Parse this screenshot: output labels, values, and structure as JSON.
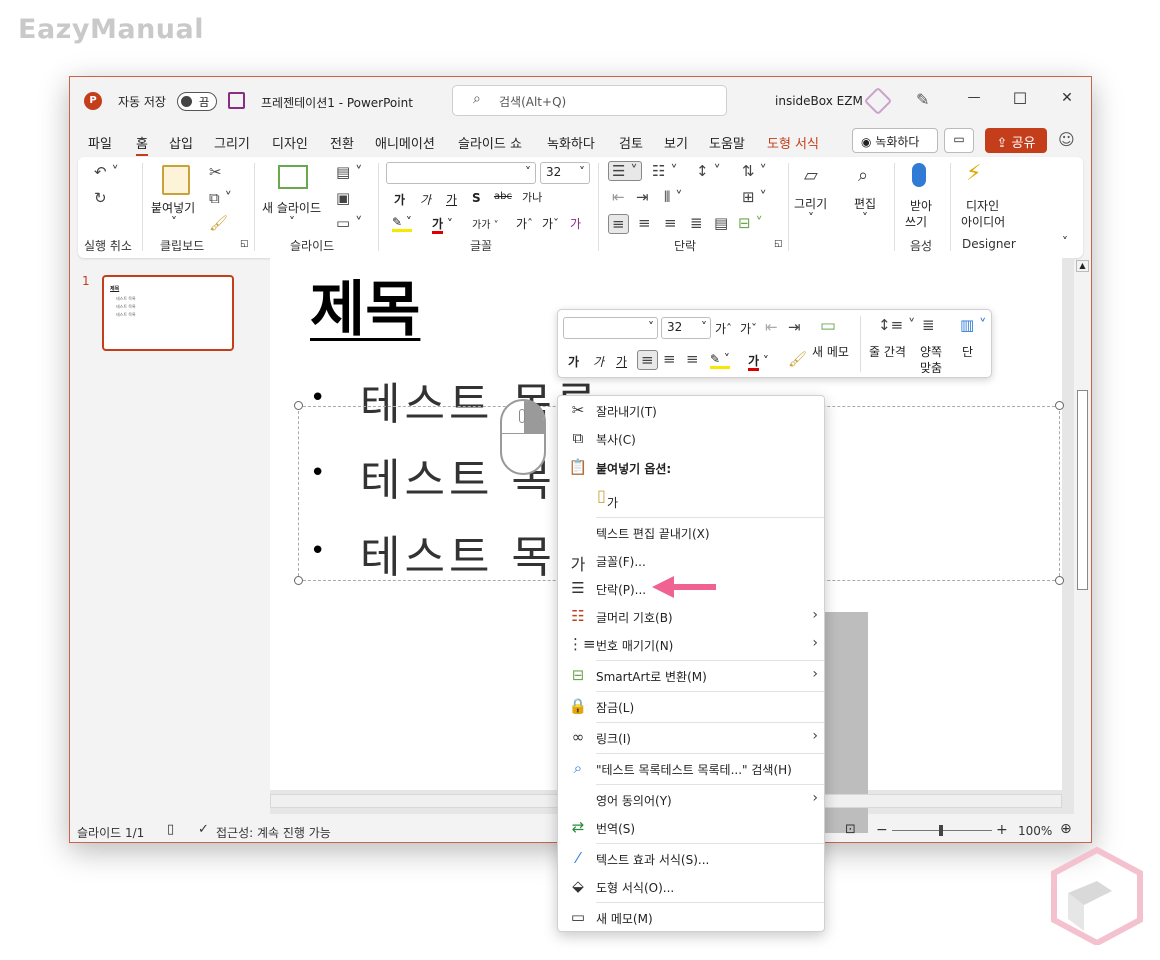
{
  "watermark": {
    "brand": "EazyManual"
  },
  "titlebar": {
    "autosave_label": "자동 저장",
    "autosave_state": "끔",
    "doc_title": "프레젠테이션1  -  PowerPoint",
    "search_placeholder": "검색(Alt+Q)",
    "user_name": "insideBox EZM",
    "minimize": "—",
    "maximize": "☐",
    "close": "✕"
  },
  "menu": {
    "tabs": [
      "파일",
      "홈",
      "삽입",
      "그리기",
      "디자인",
      "전환",
      "애니메이션",
      "슬라이드 쇼",
      "녹화하다",
      "검토",
      "보기",
      "도움말",
      "도형 서식"
    ],
    "record_label": "녹화하다",
    "share_label": "공유"
  },
  "ribbon": {
    "groups": {
      "undo": "실행 취소",
      "clipboard": "클립보드",
      "slides": "슬라이드",
      "font": "글꼴",
      "paragraph": "단락",
      "voice": "음성",
      "designer": "Designer"
    },
    "paste_label": "붙여넣기",
    "new_slide_label": "새 슬라이드",
    "font_size": "32",
    "font_name": "",
    "draw_label": "그리기",
    "edit_label": "편집",
    "dictate_label_1": "받아",
    "dictate_label_2": "쓰기",
    "designer_label_1": "디자인",
    "designer_label_2": "아이디어",
    "font_buttons": {
      "bold": "가",
      "italic": "가",
      "underline": "가",
      "strike": "S",
      "shadow": "abc",
      "spacing": "가나",
      "highlight": "가",
      "grow": "가ˆ",
      "shrink": "가ˇ",
      "clear": "가"
    }
  },
  "thumbnails": {
    "slide_number": "1",
    "title": "제목",
    "items": [
      "테스트 목록",
      "테스트 목록",
      "테스트 목록"
    ]
  },
  "slide": {
    "title": "제목",
    "bullets": [
      "테스트 목록",
      "테스트 목록",
      "테스트 목록"
    ],
    "bullet_char": "•"
  },
  "mini_toolbar": {
    "font_name": "",
    "font_size": "32",
    "new_memo_label": "새 메모",
    "line_spacing_label": "줄 간격",
    "justify_label_1": "양쪽",
    "justify_label_2": "맞춤",
    "columns_label": "단",
    "bold": "가",
    "italic": "가",
    "underline": "가",
    "grow": "가ˆ",
    "shrink": "가ˇ",
    "color_char": "가"
  },
  "context_menu": {
    "cut": "잘라내기(T)",
    "copy": "복사(C)",
    "paste_options": "붙여넣기 옵션:",
    "paste_option_char": "가",
    "exit_edit": "텍스트 편집 끝내기(X)",
    "font": "글꼴(F)...",
    "paragraph": "단락(P)...",
    "bullets": "글머리 기호(B)",
    "numbering": "번호 매기기(N)",
    "smartart": "SmartArt로 변환(M)",
    "lock": "잠금(L)",
    "link": "링크(I)",
    "search": "\"테스트 목록테스트 목록테...\" 검색(H)",
    "synonyms": "영어 동의어(Y)",
    "translate": "번역(S)",
    "text_effects": "텍스트 효과 서식(S)...",
    "shape_format": "도형 서식(O)...",
    "new_memo": "새 메모(M)"
  },
  "statusbar": {
    "slide_info": "슬라이드 1/1",
    "accessibility": "접근성: 계속 진행 가능",
    "zoom": "100%"
  },
  "colors": {
    "accent": "#c43e1c",
    "arrow": "#f06292"
  }
}
